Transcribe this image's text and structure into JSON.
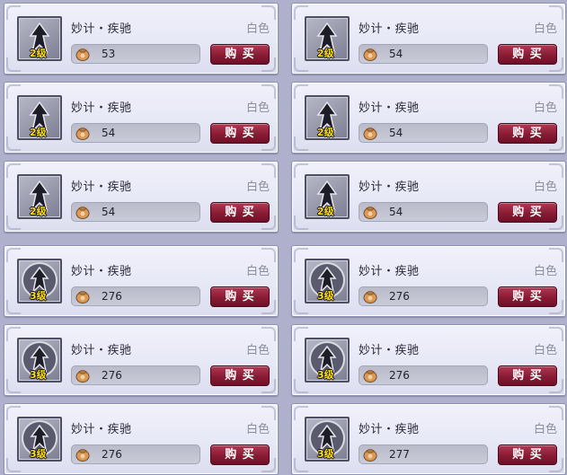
{
  "items": [
    {
      "name": "妙计・疾驰",
      "quality": "白色",
      "level": "2级",
      "price": "53",
      "buy_label": "购 买"
    },
    {
      "name": "妙计・疾驰",
      "quality": "白色",
      "level": "2级",
      "price": "54",
      "buy_label": "购 买"
    },
    {
      "name": "妙计・疾驰",
      "quality": "白色",
      "level": "2级",
      "price": "54",
      "buy_label": "购 买"
    },
    {
      "name": "妙计・疾驰",
      "quality": "白色",
      "level": "2级",
      "price": "54",
      "buy_label": "购 买"
    },
    {
      "name": "妙计・疾驰",
      "quality": "白色",
      "level": "2级",
      "price": "54",
      "buy_label": "购 买"
    },
    {
      "name": "妙计・疾驰",
      "quality": "白色",
      "level": "2级",
      "price": "54",
      "buy_label": "购 买"
    },
    {
      "name": "妙计・疾驰",
      "quality": "白色",
      "level": "3级",
      "price": "276",
      "buy_label": "购 买"
    },
    {
      "name": "妙计・疾驰",
      "quality": "白色",
      "level": "3级",
      "price": "276",
      "buy_label": "购 买"
    },
    {
      "name": "妙计・疾驰",
      "quality": "白色",
      "level": "3级",
      "price": "276",
      "buy_label": "购 买"
    },
    {
      "name": "妙计・疾驰",
      "quality": "白色",
      "level": "3级",
      "price": "276",
      "buy_label": "购 买"
    },
    {
      "name": "妙计・疾驰",
      "quality": "白色",
      "level": "3级",
      "price": "276",
      "buy_label": "购 买"
    },
    {
      "name": "妙计・疾驰",
      "quality": "白色",
      "level": "3级",
      "price": "277",
      "buy_label": "购 买"
    }
  ],
  "icons": {
    "item": "speed-tactic-icon",
    "currency": "money-pouch-icon"
  },
  "colors": {
    "buy_button": "#8a1a34",
    "level_text": "#ffe11a",
    "quality_text": "#8d8e9c"
  }
}
